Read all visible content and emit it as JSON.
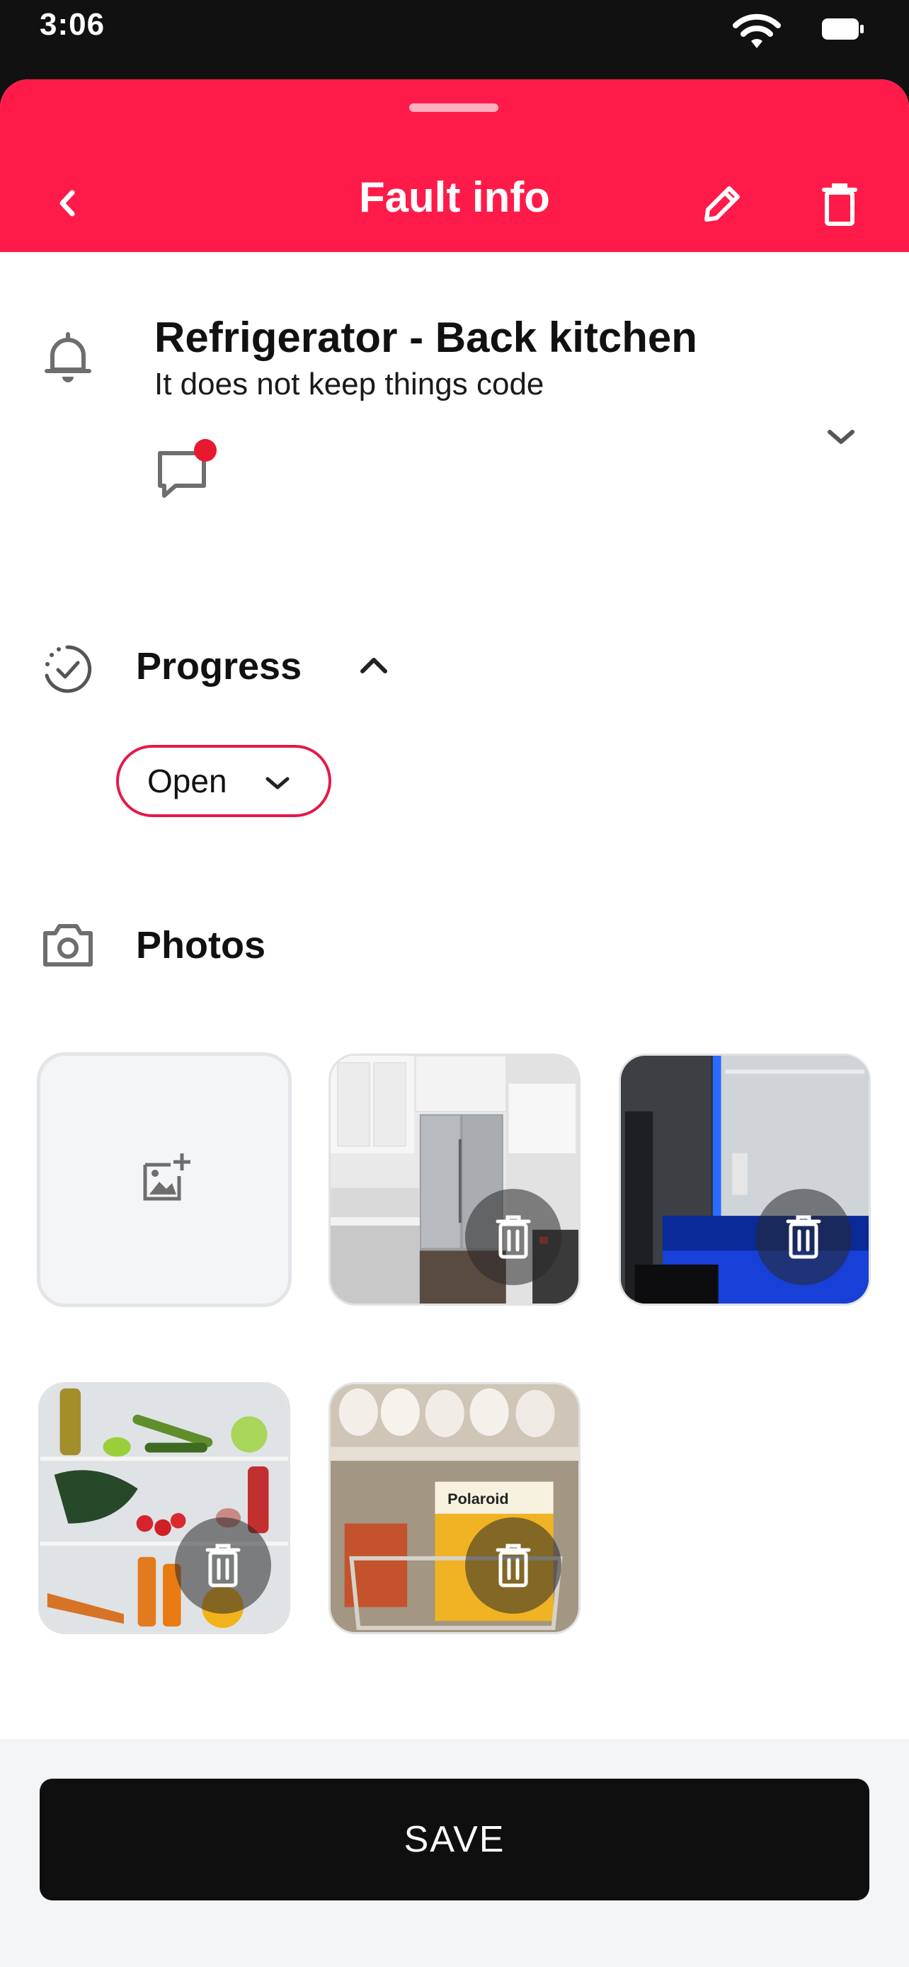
{
  "status_bar": {
    "time": "3:06",
    "wifi_icon": "wifi-icon",
    "battery_icon": "battery-icon"
  },
  "header": {
    "title": "Fault info",
    "back_icon": "chevron-left-icon",
    "edit_icon": "pencil-icon",
    "delete_icon": "trash-icon",
    "color": "#FF1B49"
  },
  "fault": {
    "title": "Refrigerator - Back kitchen",
    "description": "It does not keep things code",
    "icon": "bell-icon",
    "comment_icon": "comment-icon",
    "has_unread_comment": true
  },
  "progress": {
    "title": "Progress",
    "icon": "progress-check-icon",
    "status": "Open",
    "accent": "#E5194A"
  },
  "photos": {
    "title": "Photos",
    "icon": "camera-icon",
    "add_icon": "add-photo-icon",
    "items": [
      {
        "subject": "kitchen with steel refrigerator",
        "delete_icon": "trash-icon"
      },
      {
        "subject": "open refrigerator with blue light",
        "delete_icon": "trash-icon"
      },
      {
        "subject": "refrigerator shelves with vegetables",
        "delete_icon": "trash-icon"
      },
      {
        "subject": "eggs and polaroid box in refrigerator",
        "delete_icon": "trash-icon"
      }
    ],
    "polaroid_text": "Polaroid"
  },
  "footer": {
    "save_label": "SAVE"
  }
}
